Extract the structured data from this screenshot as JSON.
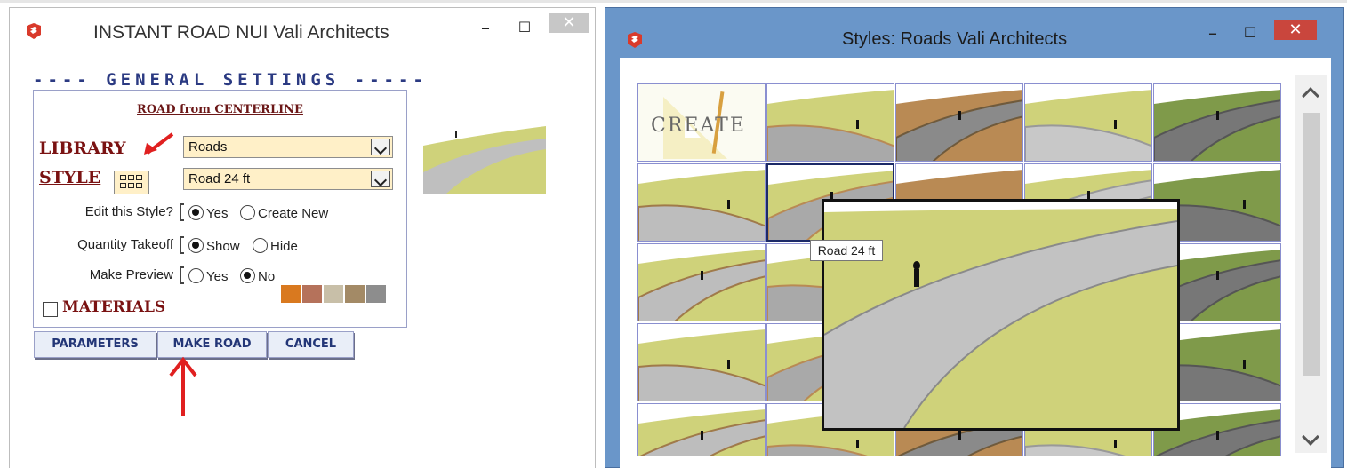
{
  "left_window": {
    "title": "INSTANT ROAD NUI  Vali Architects",
    "minimize": "–",
    "maximize": "☐",
    "close": "✕",
    "general_settings": "---- GENERAL SETTINGS -----",
    "road_from": "ROAD from CENTERLINE",
    "library_label": "LIBRARY",
    "library_value": "Roads",
    "style_label": "STYLE",
    "style_value": "Road 24 ft",
    "edit_style_label": "Edit this Style?",
    "edit_yes": "Yes",
    "edit_create_new": "Create New",
    "quantity_label": "Quantity Takeoff",
    "qty_show": "Show",
    "qty_hide": "Hide",
    "preview_label": "Make Preview",
    "prev_yes": "Yes",
    "prev_no": "No",
    "materials_label": "MATERIALS",
    "buttons": {
      "parameters": "PARAMETERS",
      "make_road": "MAKE ROAD",
      "cancel": "CANCEL"
    }
  },
  "right_window": {
    "title": "Styles: Roads   Vali Architects",
    "minimize": "–",
    "maximize": "☐",
    "close": "✕",
    "create_tile": "CREATE",
    "tooltip": "Road 24 ft"
  },
  "colors": {
    "accent_blue": "#2b3a82",
    "label_red": "#7a1212",
    "field_bg": "#fff0c8",
    "window_blue": "#6a96c9",
    "close_red": "#c9463d",
    "arrow_red": "#e02020"
  }
}
